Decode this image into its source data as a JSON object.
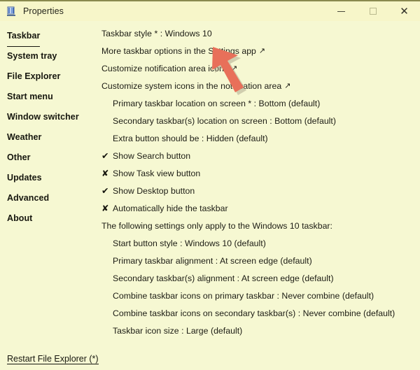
{
  "window": {
    "title": "Properties",
    "icon": "taskbar-properties-icon",
    "background_color": "#f6f8d2",
    "titlebar_color": "#f7f6c9",
    "text_color": "#1c1c14"
  },
  "titlebar_controls": [
    {
      "name": "minimize",
      "label": "–"
    },
    {
      "name": "maximize",
      "label": "□"
    },
    {
      "name": "close",
      "label": "✕"
    }
  ],
  "sidebar": {
    "items": [
      {
        "label": "Taskbar",
        "active": true
      },
      {
        "label": "System tray",
        "active": false
      },
      {
        "label": "File Explorer",
        "active": false
      },
      {
        "label": "Start menu",
        "active": false
      },
      {
        "label": "Window switcher",
        "active": false
      },
      {
        "label": "Weather",
        "active": false
      },
      {
        "label": "Other",
        "active": false
      },
      {
        "label": "Updates",
        "active": false
      },
      {
        "label": "Advanced",
        "active": false
      },
      {
        "label": "About",
        "active": false
      }
    ]
  },
  "main": {
    "rows": [
      {
        "kind": "plain",
        "indent": 0,
        "text": "Taskbar style * : Windows 10",
        "external": false
      },
      {
        "kind": "plain",
        "indent": 0,
        "text": "More taskbar options in the Settings app",
        "external": true
      },
      {
        "kind": "plain",
        "indent": 0,
        "text": "Customize notification area icons",
        "external": true
      },
      {
        "kind": "plain",
        "indent": 0,
        "text": "Customize system icons in the notification area",
        "external": true
      },
      {
        "kind": "plain",
        "indent": 1,
        "text": "Primary taskbar location on screen * : Bottom (default)",
        "external": false
      },
      {
        "kind": "plain",
        "indent": 1,
        "text": "Secondary taskbar(s) location on screen : Bottom (default)",
        "external": false
      },
      {
        "kind": "plain",
        "indent": 1,
        "text": "Extra button should be : Hidden (default)",
        "external": false
      },
      {
        "kind": "toggle",
        "indent": 0,
        "text": "Show Search button",
        "mark": "✔",
        "checked": true
      },
      {
        "kind": "toggle",
        "indent": 0,
        "text": "Show Task view button",
        "mark": "✘",
        "checked": false
      },
      {
        "kind": "toggle",
        "indent": 0,
        "text": "Show Desktop button",
        "mark": "✔",
        "checked": true
      },
      {
        "kind": "toggle",
        "indent": 0,
        "text": "Automatically hide the taskbar",
        "mark": "✘",
        "checked": false
      },
      {
        "kind": "plain",
        "indent": 0,
        "text": "The following settings only apply to the Windows 10 taskbar:",
        "external": false
      },
      {
        "kind": "plain",
        "indent": 1,
        "text": "Start button style : Windows 10 (default)",
        "external": false
      },
      {
        "kind": "plain",
        "indent": 1,
        "text": "Primary taskbar alignment : At screen edge (default)",
        "external": false
      },
      {
        "kind": "plain",
        "indent": 1,
        "text": "Secondary taskbar(s) alignment : At screen edge (default)",
        "external": false
      },
      {
        "kind": "plain",
        "indent": 1,
        "text": "Combine taskbar icons on primary taskbar : Never combine (default)",
        "external": false
      },
      {
        "kind": "plain",
        "indent": 1,
        "text": "Combine taskbar icons on secondary taskbar(s) : Never combine (default)",
        "external": false
      },
      {
        "kind": "plain",
        "indent": 1,
        "text": "Taskbar icon size : Large (default)",
        "external": false
      }
    ],
    "external_glyph": "↗"
  },
  "footer": {
    "restart_link": "Restart File Explorer (*)"
  },
  "overlay": {
    "cursor": {
      "name": "pointer-arrow-annotation",
      "color": "#e8705a",
      "shadow_color": "#b0a98a"
    }
  }
}
